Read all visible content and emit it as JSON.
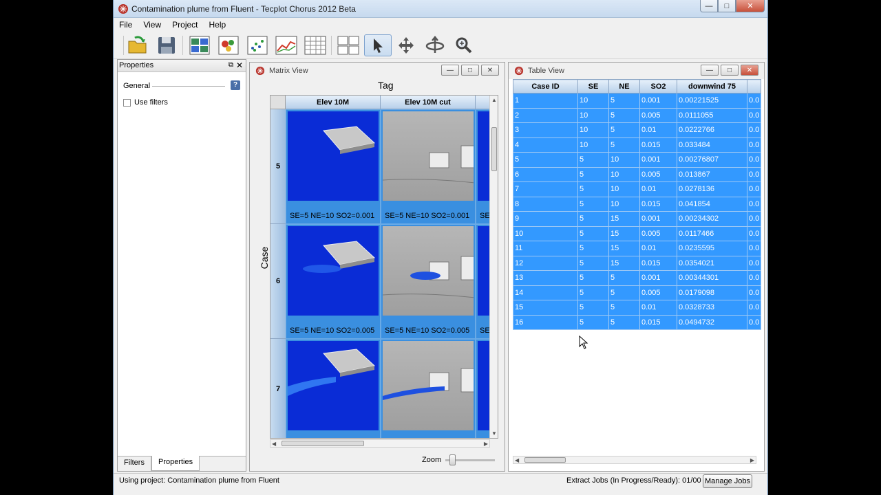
{
  "window": {
    "title": "Contamination plume from Fluent - Tecplot Chorus 2012 Beta",
    "controls": [
      "minimize",
      "maximize",
      "close"
    ]
  },
  "menubar": [
    "File",
    "View",
    "Project",
    "Help"
  ],
  "toolbar": {
    "buttons": [
      {
        "name": "open-project-icon"
      },
      {
        "name": "save-icon"
      },
      {
        "name": "matrix-view-icon"
      },
      {
        "name": "plot-icon"
      },
      {
        "name": "scatter-icon"
      },
      {
        "name": "line-plot-icon"
      },
      {
        "name": "table-icon"
      },
      {
        "name": "layout-grid-icon"
      },
      {
        "name": "select-arrow-icon",
        "active": true
      },
      {
        "name": "translate-icon"
      },
      {
        "name": "rotate-icon"
      },
      {
        "name": "zoom-icon"
      }
    ]
  },
  "properties_panel": {
    "title": "Properties",
    "section": "General",
    "use_filters_label": "Use filters",
    "use_filters_checked": false,
    "tabs": [
      "Filters",
      "Properties"
    ],
    "selected_tab": "Properties"
  },
  "matrix_view": {
    "title": "Matrix View",
    "column_axis": "Tag",
    "row_axis": "Case ID",
    "columns": [
      "Elev 10M",
      "Elev 10M cut"
    ],
    "rows": [
      {
        "id": "5",
        "caption": "SE=5  NE=10  SO2=0.001",
        "partial": "SE"
      },
      {
        "id": "6",
        "caption": "SE=5  NE=10  SO2=0.005",
        "partial": "SE"
      },
      {
        "id": "7",
        "caption": "",
        "partial": ""
      }
    ],
    "zoom_label": "Zoom"
  },
  "table_view": {
    "title": "Table View",
    "headers": [
      "Case ID",
      "SE",
      "NE",
      "SO2",
      "downwind 75",
      ""
    ],
    "rows": [
      [
        "1",
        "10",
        "5",
        "0.001",
        "0.00221525",
        "0.0"
      ],
      [
        "2",
        "10",
        "5",
        "0.005",
        "0.0111055",
        "0.0"
      ],
      [
        "3",
        "10",
        "5",
        "0.01",
        "0.0222766",
        "0.0"
      ],
      [
        "4",
        "10",
        "5",
        "0.015",
        "0.033484",
        "0.0"
      ],
      [
        "5",
        "5",
        "10",
        "0.001",
        "0.00276807",
        "0.0"
      ],
      [
        "6",
        "5",
        "10",
        "0.005",
        "0.013867",
        "0.0"
      ],
      [
        "7",
        "5",
        "10",
        "0.01",
        "0.0278136",
        "0.0"
      ],
      [
        "8",
        "5",
        "10",
        "0.015",
        "0.041854",
        "0.0"
      ],
      [
        "9",
        "5",
        "15",
        "0.001",
        "0.00234302",
        "0.0"
      ],
      [
        "10",
        "5",
        "15",
        "0.005",
        "0.0117466",
        "0.0"
      ],
      [
        "11",
        "5",
        "15",
        "0.01",
        "0.0235595",
        "0.0"
      ],
      [
        "12",
        "5",
        "15",
        "0.015",
        "0.0354021",
        "0.0"
      ],
      [
        "13",
        "5",
        "5",
        "0.001",
        "0.00344301",
        "0.0"
      ],
      [
        "14",
        "5",
        "5",
        "0.005",
        "0.0179098",
        "0.0"
      ],
      [
        "15",
        "5",
        "5",
        "0.01",
        "0.0328733",
        "0.0"
      ],
      [
        "16",
        "5",
        "5",
        "0.015",
        "0.0494732",
        "0.0"
      ]
    ]
  },
  "statusbar": {
    "project": "Using project: Contamination plume from Fluent",
    "jobs": "Extract Jobs (In Progress/Ready):  01/00",
    "manage_jobs": "Manage Jobs"
  },
  "colors": {
    "selection_blue": "#3399ff",
    "plume_blue": "#0a2cd6",
    "header_gradient": "#b8d0ea"
  }
}
